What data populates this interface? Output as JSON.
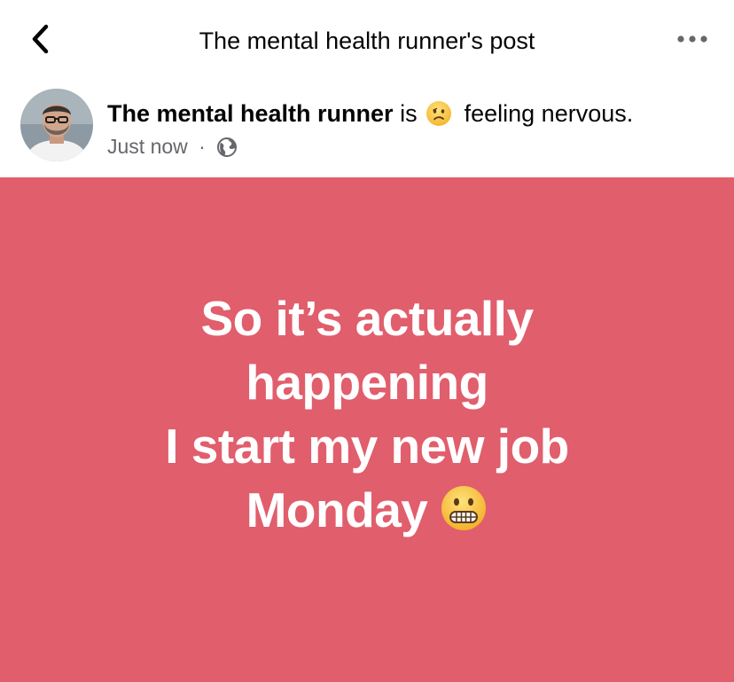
{
  "header": {
    "title": "The mental health runner's post",
    "back_icon": "chevron-left-icon",
    "more_icon": "more-horizontal-icon"
  },
  "post": {
    "author": "The mental health runner",
    "verb": "is",
    "feeling_emoji": "confused-face",
    "feeling_text": "feeling nervous.",
    "timestamp": "Just now",
    "separator": "·",
    "privacy_icon": "globe-icon",
    "background_color": "#e15e6c",
    "text_lines": [
      "So it’s actually",
      "happening",
      "I start my new job",
      "Monday"
    ],
    "trailing_emoji": "grimacing-face"
  }
}
